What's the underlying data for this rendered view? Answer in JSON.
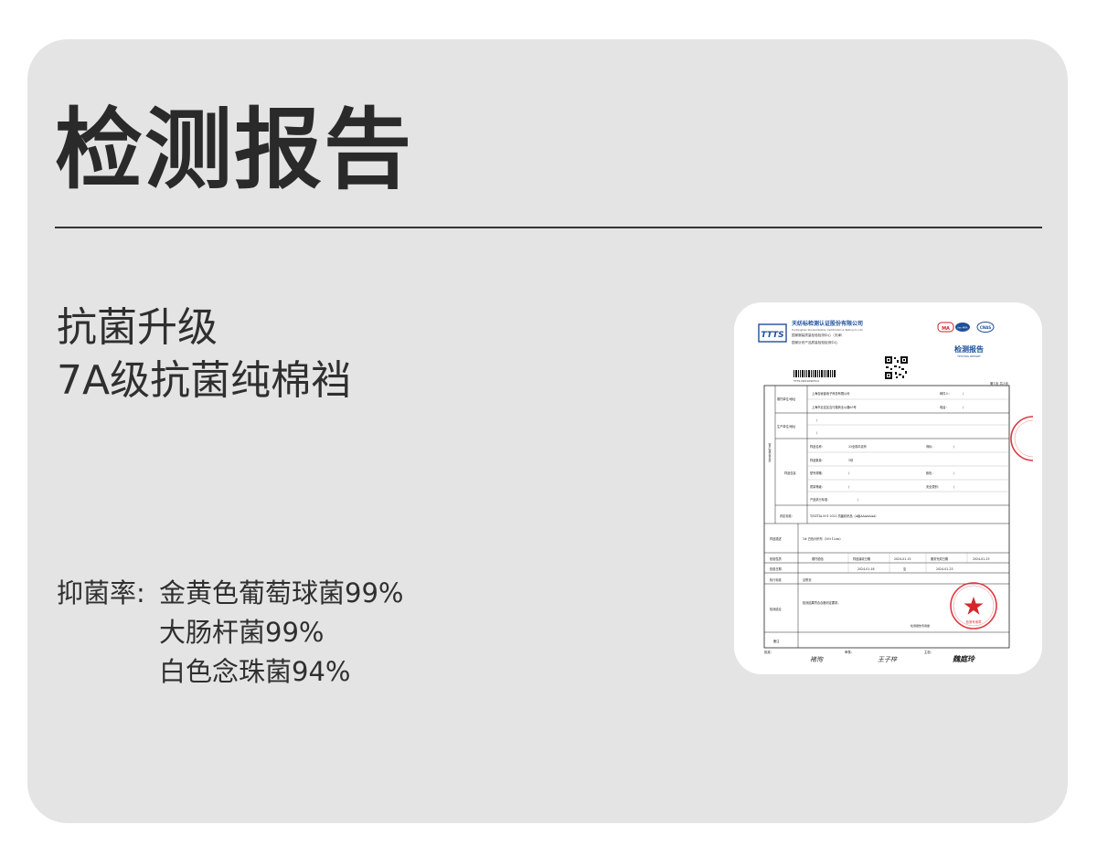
{
  "page": {
    "title": "检测报告",
    "feature_lines": [
      "抗菌升级",
      "7A级抗菌纯棉裆"
    ],
    "rates": {
      "label": "抑菌率:",
      "items": [
        "金黄色葡萄球菌99%",
        "大肠杆菌99%",
        "白色念珠菌94%"
      ]
    }
  },
  "report": {
    "logo_text": "TTTS",
    "company": "天纺标检测认证股份有限公司",
    "company_en": "Tianfangbiao Standardization Certification & Testing Co.,Ltd.",
    "center_1": "国家服装质量检验检测中心（天津）",
    "center_2": "国家针织产品质量检验检测中心",
    "doc_title": "检测报告",
    "doc_title_en": "TESTING REPORT",
    "cert_marks": [
      "MA",
      "ilac-MRA",
      "CNAS"
    ],
    "page_no": "第1页 共3页",
    "side_label": "客户提供信息栏",
    "rows": [
      {
        "label": "委托单位/地址",
        "value": "上海自睿鑫电子商务有限公司",
        "k2": "邮件人：",
        "v2": "/"
      },
      {
        "label": "",
        "value": "上海市嘉定区嘉行路商业公路65号",
        "k2": "电话：",
        "v2": "/"
      },
      {
        "label": "生产单位/地址",
        "value": "/",
        "k2": "",
        "v2": ""
      },
      {
        "label": "",
        "value": "/",
        "k2": "",
        "v2": ""
      },
      {
        "label": "样品名称：",
        "value": "33全棉平纹布",
        "k2": "商标：",
        "v2": "/"
      },
      {
        "label": "样品数量：",
        "value": "1块",
        "k2": "",
        "v2": ""
      },
      {
        "label": "型号规格：",
        "value": "/",
        "k2": "颜色：",
        "v2": "/"
      },
      {
        "label": "质量等级：",
        "value": "/",
        "k2": "安全类别：",
        "v2": "/"
      },
      {
        "label": "产品执行标准：",
        "value": "/",
        "k2": "",
        "v2": ""
      }
    ],
    "sample_info_label": "样品信息",
    "standard_label": "判定标准：",
    "standard_value": "T/SZTIA 001-2023  抗菌纺织品（A级AAAAAAA）",
    "sample_desc_label": "样品描述",
    "sample_desc_value": "1# 白色针织布（50×12cm）",
    "check_type_label": "检验性质",
    "check_type_value": "委托检验",
    "receive_label": "样品接收日期",
    "receive_value": "2024-01-15",
    "retain_label": "服务完成日期",
    "retain_value": "2024-01-23",
    "check_date_label": "检验日期",
    "check_date_value": "2024-01-16",
    "to_label": "至",
    "check_date_end": "2024-01-23",
    "exec_label": "执行标准",
    "exec_value": "见附页",
    "conclusion_label": "检测结论",
    "conclusion_value": "检测结果符合合格判定要求。",
    "stamp_note": "检测报告专用章",
    "remark_label": "备注",
    "sign_labels": [
      "批准：",
      "审核：",
      "主检："
    ],
    "signatures": [
      "褚恂",
      "王子梓",
      "魏庭玲"
    ],
    "stamp_text": "天纺标检测认证股份有限公司",
    "stamp_sub": "检测专用章",
    "barcode_text": "TTTS-N221090514"
  }
}
